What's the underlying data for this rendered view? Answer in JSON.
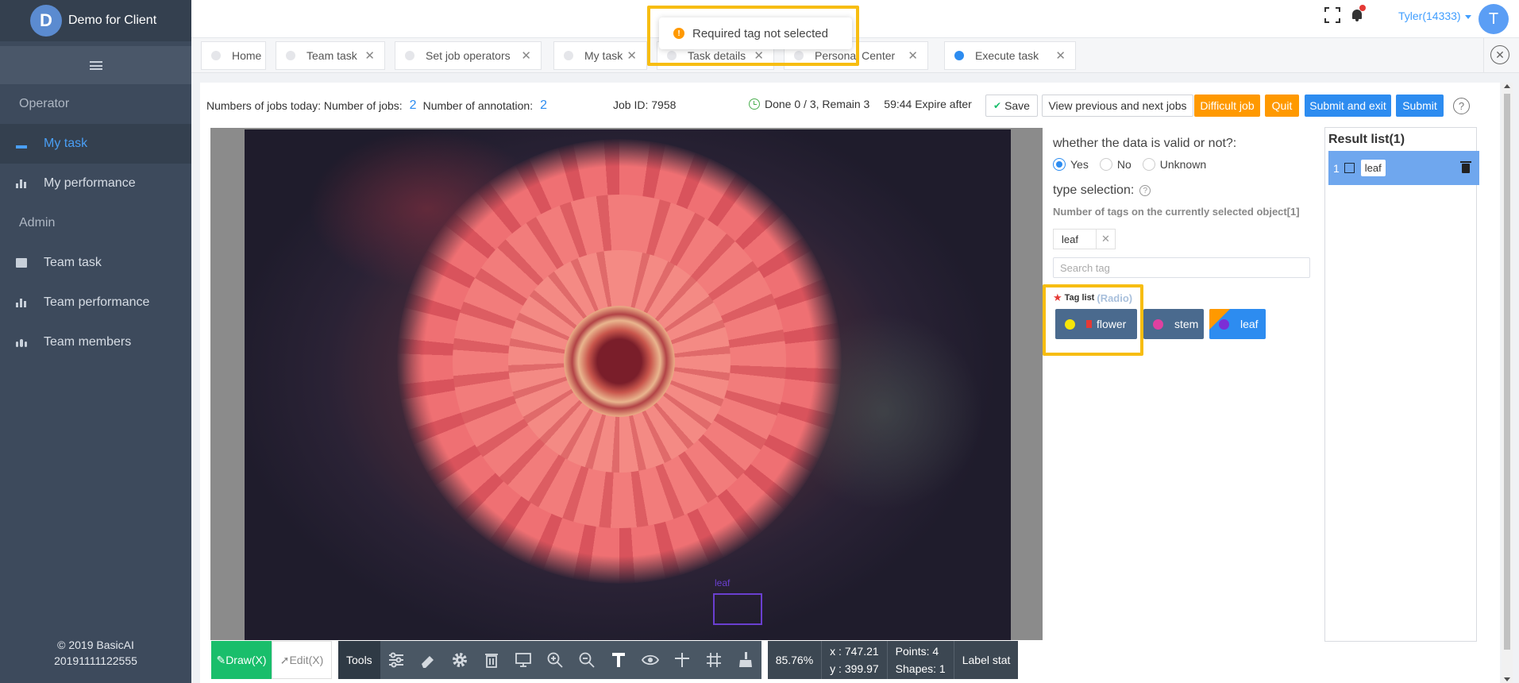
{
  "brand": {
    "logo_letter": "D",
    "name": "Demo for Client"
  },
  "sidebar": {
    "sections": [
      {
        "title": "Operator",
        "items": [
          {
            "label": "My task",
            "icon": "layers-icon",
            "active": true
          },
          {
            "label": "My performance",
            "icon": "bar-chart-icon",
            "active": false
          }
        ]
      },
      {
        "title": "Admin",
        "items": [
          {
            "label": "Team task",
            "icon": "folder-icon",
            "active": false
          },
          {
            "label": "Team performance",
            "icon": "bar-chart-icon",
            "active": false
          },
          {
            "label": "Team members",
            "icon": "users-icon",
            "active": false
          }
        ]
      }
    ],
    "copyright": "© 2019 BasicAI",
    "build": "20191111122555"
  },
  "header": {
    "user": "Tyler(14333)",
    "avatar_letter": "T"
  },
  "tabs": [
    {
      "label": "Home",
      "closable": false,
      "active": false
    },
    {
      "label": "Team task",
      "closable": true,
      "active": false
    },
    {
      "label": "Set job operators",
      "closable": true,
      "active": false
    },
    {
      "label": "My task",
      "closable": true,
      "active": false
    },
    {
      "label": "Task details",
      "closable": true,
      "active": false
    },
    {
      "label": "Personal Center",
      "closable": true,
      "active": false
    },
    {
      "label": "Execute task",
      "closable": true,
      "active": true
    }
  ],
  "toast": {
    "message": "Required tag not selected",
    "color": "#ff9900"
  },
  "info": {
    "jobs_today_label": "Numbers of jobs today: Number of jobs:",
    "jobs_count": "2",
    "annotation_label": "Number of annotation:",
    "annotation_count": "2",
    "job_id": "Job ID: 7958",
    "progress": "Done 0 / 3, Remain 3",
    "expire": "59:44 Expire after"
  },
  "actions": {
    "save": "Save",
    "view_jobs": "View previous and next jobs",
    "difficult": "Difficult job",
    "quit": "Quit",
    "submit_exit": "Submit and exit",
    "submit": "Submit",
    "help": "?"
  },
  "canvas": {
    "bbox_label": "leaf"
  },
  "toolbar": {
    "draw": "Draw(X)",
    "edit": "Edit(X)",
    "tools_label": "Tools",
    "zoom": "85.76%",
    "x": "x : 747.21",
    "y": "y : 399.97",
    "points": "Points:  4",
    "shapes": "Shapes:  1",
    "label_stat": "Label stat"
  },
  "attributes": {
    "validity_question": "whether the data is valid or not?:",
    "validity_options": [
      "Yes",
      "No",
      "Unknown"
    ],
    "validity_selected": "Yes",
    "type_selection": "type selection:",
    "tag_count_text": "Number of tags on the currently selected object[1]",
    "selected_tag": "leaf",
    "search_placeholder": "Search tag",
    "tag_list_label": "Tag list",
    "tag_list_mode": "(Radio)",
    "tags": [
      {
        "label": "flower",
        "color": "#f5e50a"
      },
      {
        "label": "stem",
        "color": "#e040a0"
      },
      {
        "label": "leaf",
        "color": "#7b2fd6"
      }
    ]
  },
  "result": {
    "title": "Result list(1)",
    "items": [
      {
        "index": "1",
        "label": "leaf"
      }
    ]
  },
  "colors": {
    "highlight": "#f7bd11",
    "primary": "#2d8cf0",
    "warning": "#ff9900",
    "success": "#19be6b"
  }
}
